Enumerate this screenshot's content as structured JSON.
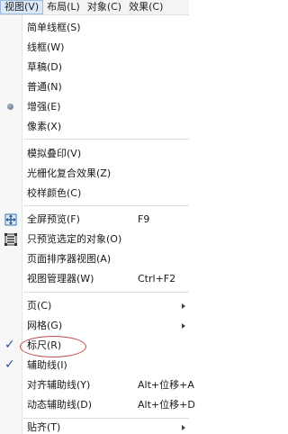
{
  "menubar": {
    "items": [
      {
        "label": "视图(V)"
      },
      {
        "label": "布局(L)"
      },
      {
        "label": "对象(C)"
      },
      {
        "label": "效果(C)"
      }
    ]
  },
  "menu": {
    "items": [
      {
        "label": "简单线框(S)"
      },
      {
        "label": "线框(W)"
      },
      {
        "label": "草稿(D)"
      },
      {
        "label": "普通(N)"
      },
      {
        "label": "增强(E)"
      },
      {
        "label": "像素(X)"
      },
      {
        "label": "模拟叠印(V)"
      },
      {
        "label": "光栅化复合效果(Z)"
      },
      {
        "label": "校样颜色(C)"
      },
      {
        "label": "全屏预览(F)",
        "shortcut": "F9"
      },
      {
        "label": "只预览选定的对象(O)"
      },
      {
        "label": "页面排序器视图(A)"
      },
      {
        "label": "视图管理器(W)",
        "shortcut": "Ctrl+F2"
      },
      {
        "label": "页(C)"
      },
      {
        "label": "网格(G)"
      },
      {
        "label": "标尺(R)"
      },
      {
        "label": "辅助线(I)"
      },
      {
        "label": "对齐辅助线(Y)",
        "shortcut": "Alt+位移+A"
      },
      {
        "label": "动态辅助线(D)",
        "shortcut": "Alt+位移+D"
      },
      {
        "label": "贴齐(T)"
      }
    ]
  },
  "icons": {
    "enhanced": "radio-dot-icon",
    "fullscreen": "fullscreen-preview-icon",
    "preview_selected": "preview-selected-icon",
    "ruler": "checkmark-icon",
    "guidelines": "checkmark-icon"
  },
  "colors": {
    "check": "#2a5aa8",
    "highlight_circle": "#c24a4a",
    "active_menu": "#dbe8f8"
  }
}
